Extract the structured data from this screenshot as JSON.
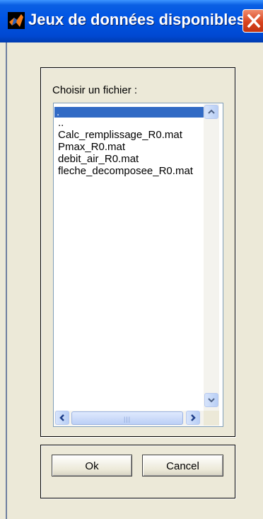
{
  "window": {
    "title": "Jeux de données disponibles",
    "close_glyph": "✕"
  },
  "file_panel": {
    "prompt": "Choisir un fichier :",
    "files": [
      ".",
      "..",
      "Calc_remplissage_R0.mat",
      "Pmax_R0.mat",
      "debit_air_R0.mat",
      "fleche_decomposee_R0.mat"
    ],
    "selected_index": 0
  },
  "buttons": {
    "ok": "Ok",
    "cancel": "Cancel"
  },
  "colors": {
    "titlebar": "#0054e3",
    "selection": "#316ac5",
    "dialog_bg": "#ece9d8"
  }
}
